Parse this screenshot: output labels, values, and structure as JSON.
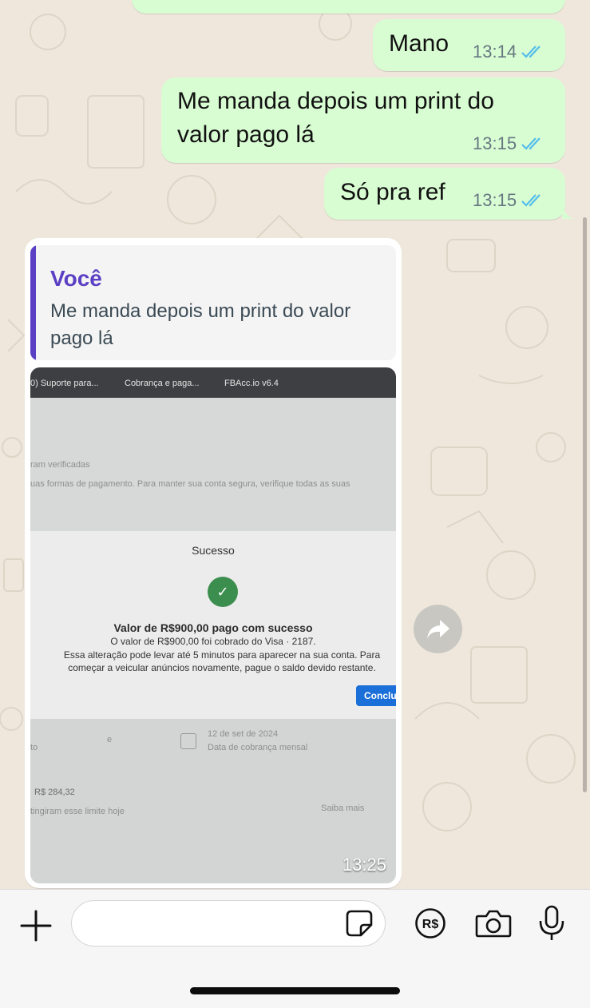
{
  "messages_out": [
    {
      "text": "Mano",
      "time": "13:14",
      "status": "read"
    },
    {
      "text": "Me manda depois um print do valor pago lá",
      "lines": [
        "Me manda depois um print do",
        "valor pago lá"
      ],
      "time": "13:15",
      "status": "read"
    },
    {
      "text": "Só pra ref",
      "time": "13:15",
      "status": "read"
    }
  ],
  "message_in": {
    "quote": {
      "author": "Você",
      "text": "Me manda depois um print do valor pago lá"
    },
    "time": "13:25",
    "photo": {
      "tabs": [
        "0) Suporte para...",
        "Cobrança e paga...",
        "FBAcc.io v6.4"
      ],
      "bg_line1": "ram verificadas",
      "bg_line2": "uas formas de pagamento. Para manter sua conta segura, verifique todas as suas",
      "modal_title": "Sucesso",
      "headline": "Valor de R$900,00 pago com sucesso",
      "detail": "O valor de R$900,00 foi cobrado do Visa · 2187.",
      "note": "Essa alteração pode levar até 5 minutos para aparecer na sua conta. Para começar a veicular anúncios novamente, pague o saldo devido restante.",
      "done_button": "Conclu",
      "billing_date": "12 de set de 2024",
      "billing_label": "Data de cobrança mensal",
      "amount": "R$ 284,32",
      "limit_text": "tingiram esse limite hoje",
      "learn_more": "Saiba mais",
      "left_fragment": "to",
      "mid_fragment": "e"
    }
  },
  "composer": {
    "placeholder": "",
    "icons": [
      "plus-icon",
      "sticker-icon",
      "payment-icon",
      "camera-icon",
      "microphone-icon"
    ]
  },
  "colors": {
    "outgoing_bubble": "#d9fdd3",
    "incoming_bubble": "#ffffff",
    "read_tick": "#53bdeb",
    "quote_accent": "#5b3fc4",
    "chat_background": "#efe7dc"
  }
}
